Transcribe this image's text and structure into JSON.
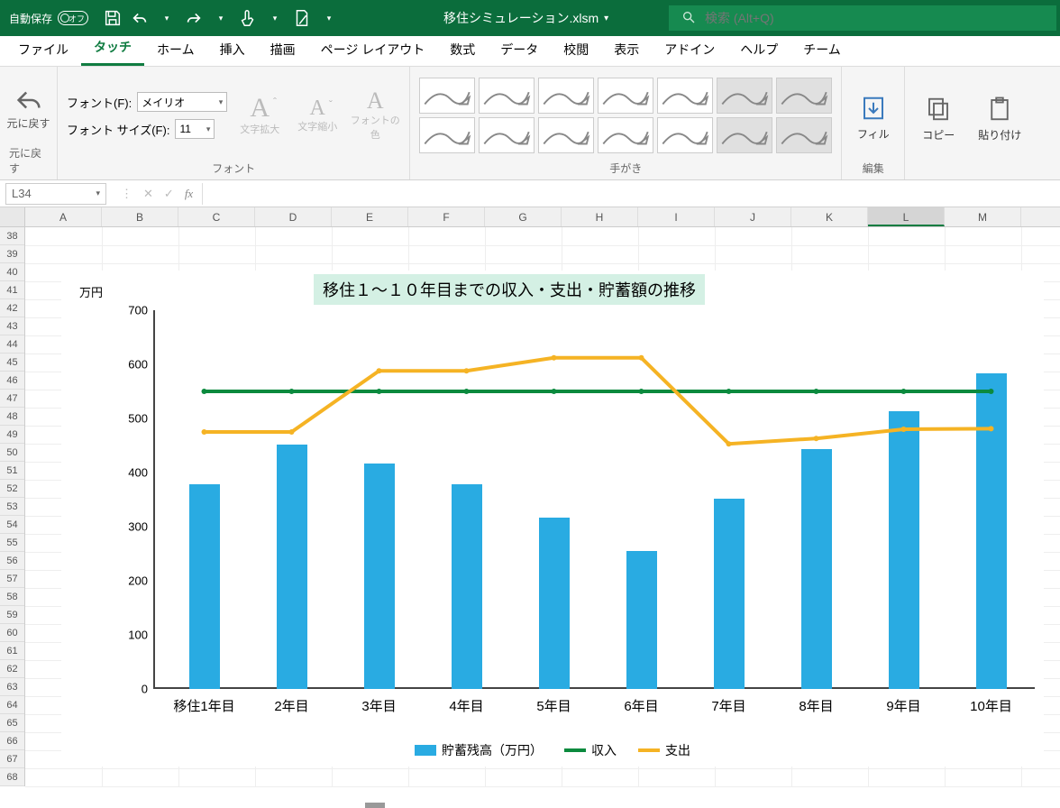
{
  "titlebar": {
    "autosave_label": "自動保存",
    "autosave_state": "オフ",
    "document_name": "移住シミュレーション.xlsm",
    "search_placeholder": "検索 (Alt+Q)"
  },
  "tabs": {
    "file": "ファイル",
    "touch": "タッチ",
    "home": "ホーム",
    "insert": "挿入",
    "draw": "描画",
    "page_layout": "ページ レイアウト",
    "formulas": "数式",
    "data": "データ",
    "review": "校閲",
    "view": "表示",
    "addins": "アドイン",
    "help": "ヘルプ",
    "team": "チーム"
  },
  "ribbon": {
    "undo_group_label": "元に戻す",
    "undo_label": "元に戻す",
    "font_group_label": "フォント",
    "font_label": "フォント(F):",
    "font_value": "メイリオ",
    "size_label": "フォント サイズ(F):",
    "size_value": "11",
    "enlarge_label": "文字拡大",
    "shrink_label": "文字縮小",
    "fontcolor_label": "フォントの色",
    "ink_group_label": "手がき",
    "edit_group_label": "編集",
    "fill_label": "フィル",
    "copy_label": "コピー",
    "paste_label": "貼り付け"
  },
  "namebox": {
    "value": "L34"
  },
  "columns": [
    "A",
    "B",
    "C",
    "D",
    "E",
    "F",
    "G",
    "H",
    "I",
    "J",
    "K",
    "L",
    "M"
  ],
  "row_start": 38,
  "row_end": 68,
  "selected_col": "L",
  "chart_data": {
    "type": "bar+line",
    "title": "移住１～１０年目までの収入・支出・貯蓄額の推移",
    "y_unit": "万円",
    "ylim": [
      0,
      700
    ],
    "yticks": [
      0,
      100,
      200,
      300,
      400,
      500,
      600,
      700
    ],
    "categories": [
      "移住1年目",
      "2年目",
      "3年目",
      "4年目",
      "5年目",
      "6年目",
      "7年目",
      "8年目",
      "9年目",
      "10年目"
    ],
    "bars": {
      "name": "貯蓄残高（万円）",
      "values": [
        378,
        452,
        416,
        378,
        316,
        255,
        351,
        444,
        513,
        583
      ]
    },
    "lines": [
      {
        "name": "収入",
        "color": "#0b8a3e",
        "values": [
          550,
          550,
          550,
          550,
          550,
          550,
          550,
          550,
          550,
          550
        ]
      },
      {
        "name": "支出",
        "color": "#f5b324",
        "values": [
          475,
          475,
          588,
          588,
          612,
          612,
          453,
          463,
          480,
          481
        ]
      }
    ],
    "legend": [
      "貯蓄残高（万円）",
      "収入",
      "支出"
    ]
  }
}
